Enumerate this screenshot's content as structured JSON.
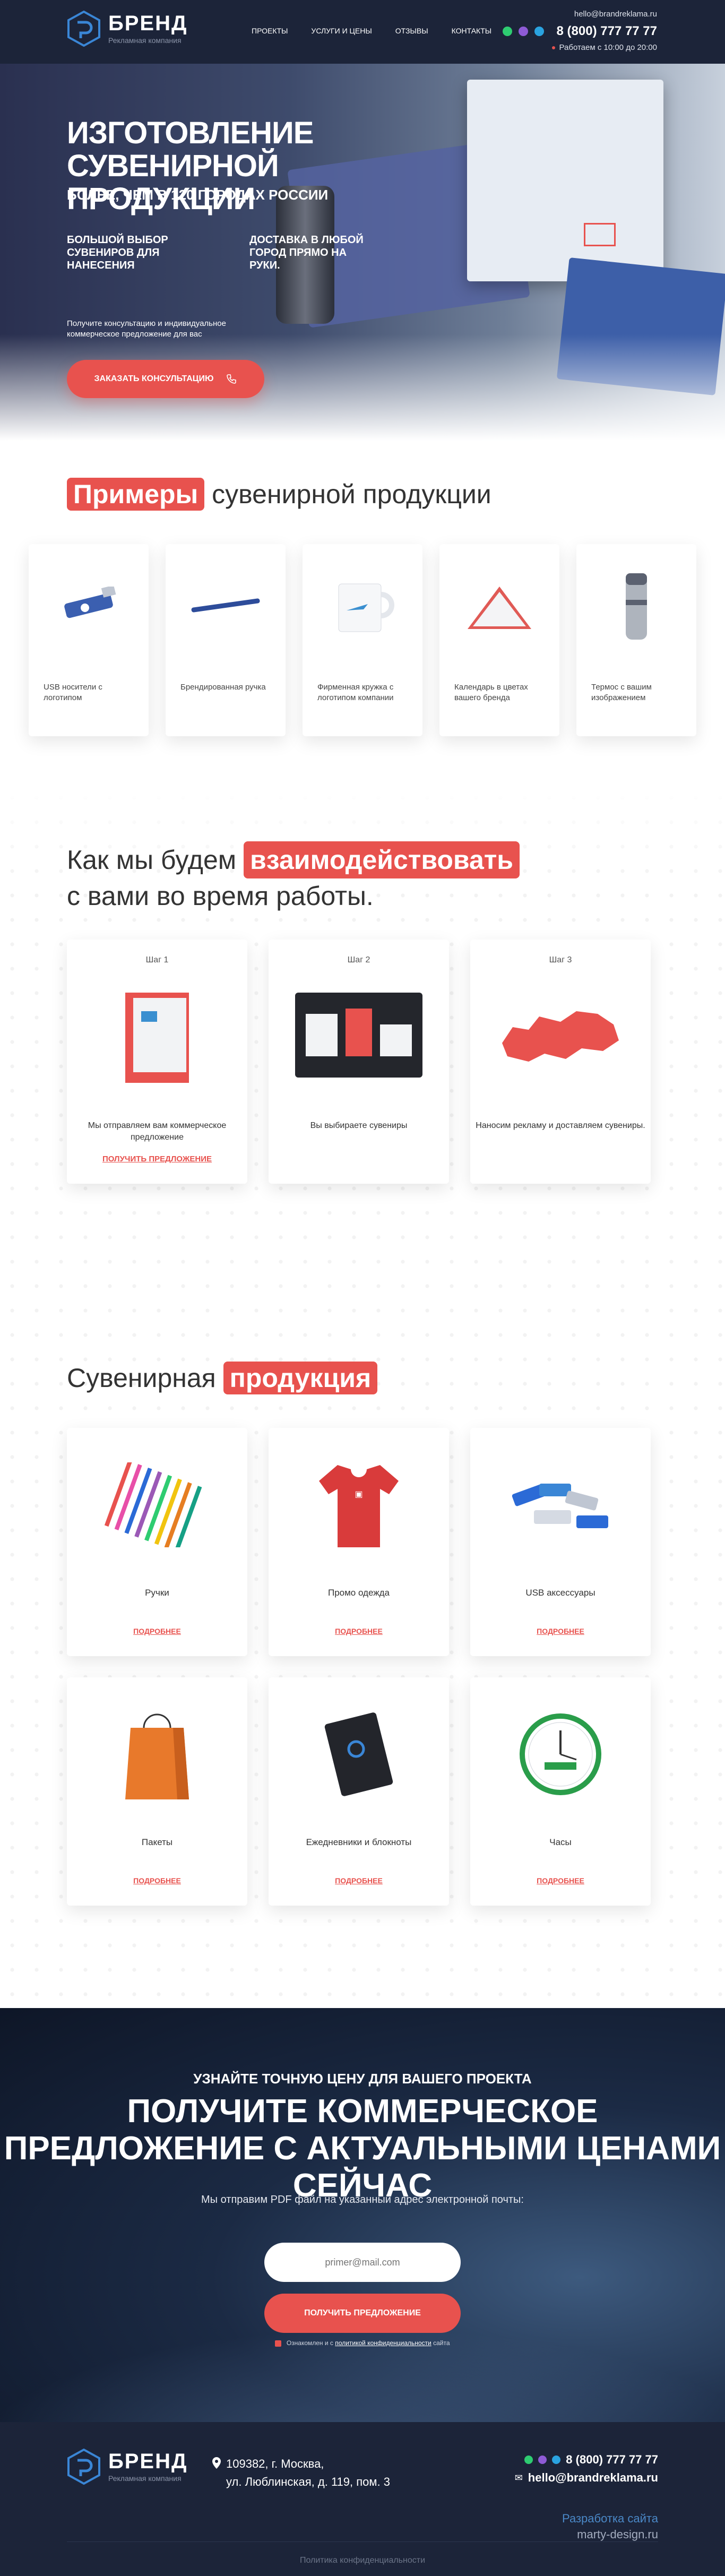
{
  "brand": {
    "name": "БРЕНД",
    "tagline": "Рекламная компания"
  },
  "nav": [
    "ПРОЕКТЫ",
    "УСЛУГИ И ЦЕНЫ",
    "ОТЗЫВЫ",
    "КОНТАКТЫ"
  ],
  "header": {
    "email": "hello@brandreklama.ru",
    "phone": "8 (800) 777 77 77",
    "hours": "Работаем с 10:00 до 20:00"
  },
  "hero": {
    "title": "ИЗГОТОВЛЕНИЕ СУВЕНИРНОЙ ПРОДУКЦИИ",
    "subtitle": "БОЛЕЕ, ЧЕМ В 120 ГОРОДАХ РОССИИ",
    "feature_1": "БОЛЬШОЙ ВЫБОР СУВЕНИРОВ ДЛЯ НАНЕСЕНИЯ",
    "feature_2": "ДОСТАВКА В ЛЮБОЙ ГОРОД ПРЯМО НА РУКИ.",
    "lead": "Получите консультацию и индивидуальное коммерческое предложение для вас",
    "cta": "ЗАКАЗАТЬ КОНСУЛЬТАЦИЮ"
  },
  "examples": {
    "title_highlight": "Примеры",
    "title_rest": "сувенирной продукции",
    "items": [
      {
        "label": "USB носители с логотипом",
        "icon": "usb-icon"
      },
      {
        "label": "Брендированная ручка",
        "icon": "pen-icon"
      },
      {
        "label": "Фирменная кружка с логотипом компании",
        "icon": "mug-icon"
      },
      {
        "label": "Календарь в цветах вашего бренда",
        "icon": "calendar-icon"
      },
      {
        "label": "Термос с вашим изображением",
        "icon": "thermos-icon"
      }
    ]
  },
  "steps": {
    "title_line1": "Как мы будем",
    "title_highlight": "взаимодействовать",
    "title_line2": "с вами во время работы.",
    "items": [
      {
        "num": "Шаг 1",
        "text": "Мы отправляем вам коммерческое предложение",
        "link": "ПОЛУЧИТЬ ПРЕДЛОЖЕНИЕ"
      },
      {
        "num": "Шаг 2",
        "text": "Вы выбираете сувениры",
        "link": ""
      },
      {
        "num": "Шаг 3",
        "text": "Наносим рекламу и доставляем сувениры.",
        "link": ""
      }
    ]
  },
  "products": {
    "title_rest": "Сувенирная",
    "title_highlight": "продукция",
    "more_label": "ПОДРОБНЕЕ",
    "items": [
      {
        "name": "Ручки",
        "icon": "pens-icon"
      },
      {
        "name": "Промо одежда",
        "icon": "tshirt-icon"
      },
      {
        "name": "USB аксессуары",
        "icon": "usb-accessories-icon"
      },
      {
        "name": "Пакеты",
        "icon": "bag-icon"
      },
      {
        "name": "Ежедневники и блокноты",
        "icon": "notebook-icon"
      },
      {
        "name": "Часы",
        "icon": "clock-icon"
      }
    ]
  },
  "cta2": {
    "sub": "УЗНАЙТЕ ТОЧНУЮ ЦЕНУ ДЛЯ ВАШЕГО ПРОЕКТА",
    "title": "ПОЛУЧИТЕ КОММЕРЧЕСКОЕ ПРЕДЛОЖЕНИЕ С АКТУАЛЬНЫМИ ЦЕНАМИ СЕЙЧАС",
    "lead": "Мы отправим PDF файл на указанный адрес электронной почты:",
    "placeholder": "primer@mail.com",
    "button": "ПОЛУЧИТЬ ПРЕДЛОЖЕНИЕ",
    "consent_pre": "Ознакомлен и с",
    "consent_link": "политикой конфиденциальности",
    "consent_post": "сайта"
  },
  "footer": {
    "address_1": "109382, г. Москва,",
    "address_2": "ул. Люблинская, д. 119, пом. 3",
    "phone": "8 (800) 777 77 77",
    "email": "hello@brandreklama.ru",
    "dev_1": "Разработка сайта",
    "dev_2": "marty-design.ru",
    "policy": "Политика конфиденциальности"
  },
  "colors": {
    "accent": "#e8524e",
    "dark": "#1c2439",
    "link_blue": "#4a88c7"
  }
}
